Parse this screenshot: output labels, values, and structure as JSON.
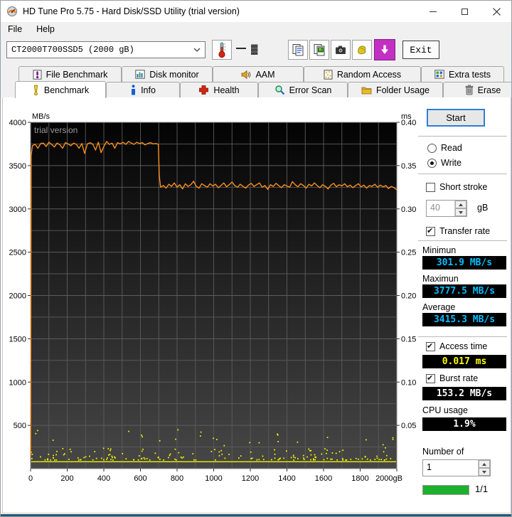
{
  "window": {
    "title": "HD Tune Pro 5.75 - Hard Disk/SSD Utility (trial version)"
  },
  "menu": {
    "file": "File",
    "help": "Help"
  },
  "toolbar": {
    "drive_selector": "CT2000T700SSD5 (2000 gB)",
    "temperature_glyph": "▓",
    "exit_label": "Exit"
  },
  "tabs": {
    "row1": [
      {
        "label": "File Benchmark"
      },
      {
        "label": "Disk monitor"
      },
      {
        "label": "AAM"
      },
      {
        "label": "Random Access"
      },
      {
        "label": "Extra tests"
      }
    ],
    "row2": [
      {
        "label": "Benchmark",
        "active": true
      },
      {
        "label": "Info"
      },
      {
        "label": "Health"
      },
      {
        "label": "Error Scan"
      },
      {
        "label": "Folder Usage"
      },
      {
        "label": "Erase"
      }
    ]
  },
  "controls": {
    "start_label": "Start",
    "read": {
      "label": "Read",
      "checked": false
    },
    "write": {
      "label": "Write",
      "checked": true
    },
    "short_stroke": {
      "label": "Short stroke",
      "checked": false,
      "value": "40",
      "unit": "gB"
    },
    "transfer_rate": {
      "label": "Transfer rate",
      "checked": true
    },
    "minimum": {
      "label": "Minimun",
      "value": "301.9 MB/s"
    },
    "maximum": {
      "label": "Maximun",
      "value": "3777.5 MB/s"
    },
    "average": {
      "label": "Average",
      "value": "3415.3 MB/s"
    },
    "access_time": {
      "label": "Access time",
      "checked": true,
      "value": "0.017 ms"
    },
    "burst_rate": {
      "label": "Burst rate",
      "checked": true,
      "value": "153.2 MB/s"
    },
    "cpu_usage": {
      "label": "CPU usage",
      "value": "1.9%"
    },
    "number_of": {
      "label": "Number of",
      "value": "1"
    },
    "progress": {
      "fraction": 1,
      "text": "1/1"
    }
  },
  "colors": {
    "lcd_cyan": "#00bfff",
    "lcd_yellow": "#ffff00",
    "lcd_white": "#ffffff",
    "progress_green": "#1cb02c",
    "series_orange": "#f78f1e",
    "series_yellow": "#ffff00"
  },
  "chart_data": {
    "type": "line",
    "title_overlay": "trial version",
    "x_axis": {
      "min": 0,
      "max": 2000,
      "tick_step": 200,
      "grid_step": 100,
      "labels": [
        "0",
        "200",
        "400",
        "600",
        "800",
        "1000",
        "1200",
        "1400",
        "1600",
        "1800",
        "2000gB"
      ]
    },
    "y_left": {
      "label": "MB/s",
      "min": 0,
      "max": 4000,
      "tick_step": 500,
      "grid_step": 250,
      "labels": [
        "4000",
        "3500",
        "3000",
        "2500",
        "2000",
        "1500",
        "1000",
        "500"
      ]
    },
    "y_right": {
      "label": "ms",
      "min": 0,
      "max": 0.4,
      "tick_step": 0.05,
      "labels": [
        "0.40",
        "0.35",
        "0.30",
        "0.25",
        "0.20",
        "0.15",
        "0.10",
        "0.05"
      ]
    },
    "series": [
      {
        "name": "write-transfer-rate",
        "color": "#f78f1e",
        "style": "line",
        "points": [
          [
            0,
            150
          ],
          [
            3,
            3620
          ],
          [
            10,
            3730
          ],
          [
            25,
            3745
          ],
          [
            40,
            3700
          ],
          [
            55,
            3755
          ],
          [
            70,
            3760
          ],
          [
            85,
            3720
          ],
          [
            100,
            3770
          ],
          [
            115,
            3745
          ],
          [
            130,
            3715
          ],
          [
            145,
            3760
          ],
          [
            160,
            3740
          ],
          [
            175,
            3700
          ],
          [
            190,
            3765
          ],
          [
            205,
            3750
          ],
          [
            220,
            3730
          ],
          [
            235,
            3760
          ],
          [
            250,
            3745
          ],
          [
            265,
            3700
          ],
          [
            280,
            3755
          ],
          [
            295,
            3640
          ],
          [
            310,
            3750
          ],
          [
            325,
            3765
          ],
          [
            340,
            3745
          ],
          [
            355,
            3680
          ],
          [
            370,
            3770
          ],
          [
            385,
            3650
          ],
          [
            400,
            3720
          ],
          [
            415,
            3780
          ],
          [
            430,
            3745
          ],
          [
            445,
            3760
          ],
          [
            460,
            3700
          ],
          [
            475,
            3765
          ],
          [
            490,
            3750
          ],
          [
            505,
            3770
          ],
          [
            520,
            3745
          ],
          [
            535,
            3780
          ],
          [
            550,
            3760
          ],
          [
            565,
            3745
          ],
          [
            580,
            3770
          ],
          [
            595,
            3755
          ],
          [
            610,
            3765
          ],
          [
            625,
            3740
          ],
          [
            640,
            3755
          ],
          [
            655,
            3765
          ],
          [
            670,
            3750
          ],
          [
            685,
            3755
          ],
          [
            698,
            3745
          ],
          [
            703,
            3380
          ],
          [
            710,
            3250
          ],
          [
            725,
            3270
          ],
          [
            740,
            3240
          ],
          [
            755,
            3285
          ],
          [
            770,
            3260
          ],
          [
            785,
            3300
          ],
          [
            800,
            3250
          ],
          [
            815,
            3280
          ],
          [
            830,
            3230
          ],
          [
            845,
            3290
          ],
          [
            860,
            3260
          ],
          [
            875,
            3280
          ],
          [
            890,
            3320
          ],
          [
            905,
            3260
          ],
          [
            920,
            3240
          ],
          [
            935,
            3290
          ],
          [
            950,
            3270
          ],
          [
            965,
            3250
          ],
          [
            980,
            3290
          ],
          [
            995,
            3265
          ],
          [
            1010,
            3285
          ],
          [
            1025,
            3245
          ],
          [
            1040,
            3270
          ],
          [
            1055,
            3300
          ],
          [
            1070,
            3255
          ],
          [
            1085,
            3280
          ],
          [
            1100,
            3310
          ],
          [
            1115,
            3270
          ],
          [
            1130,
            3250
          ],
          [
            1145,
            3285
          ],
          [
            1160,
            3260
          ],
          [
            1175,
            3240
          ],
          [
            1190,
            3275
          ],
          [
            1205,
            3295
          ],
          [
            1220,
            3260
          ],
          [
            1235,
            3280
          ],
          [
            1250,
            3300
          ],
          [
            1265,
            3250
          ],
          [
            1280,
            3270
          ],
          [
            1295,
            3225
          ],
          [
            1310,
            3280
          ],
          [
            1325,
            3260
          ],
          [
            1340,
            3295
          ],
          [
            1355,
            3270
          ],
          [
            1370,
            3245
          ],
          [
            1385,
            3280
          ],
          [
            1400,
            3265
          ],
          [
            1415,
            3250
          ],
          [
            1430,
            3315
          ],
          [
            1445,
            3280
          ],
          [
            1460,
            3255
          ],
          [
            1475,
            3290
          ],
          [
            1490,
            3270
          ],
          [
            1505,
            3240
          ],
          [
            1520,
            3285
          ],
          [
            1535,
            3265
          ],
          [
            1550,
            3300
          ],
          [
            1565,
            3270
          ],
          [
            1580,
            3245
          ],
          [
            1595,
            3280
          ],
          [
            1610,
            3260
          ],
          [
            1625,
            3230
          ],
          [
            1640,
            3275
          ],
          [
            1655,
            3295
          ],
          [
            1670,
            3255
          ],
          [
            1685,
            3280
          ],
          [
            1700,
            3265
          ],
          [
            1715,
            3290
          ],
          [
            1730,
            3255
          ],
          [
            1745,
            3275
          ],
          [
            1760,
            3245
          ],
          [
            1775,
            3270
          ],
          [
            1790,
            3290
          ],
          [
            1805,
            3255
          ],
          [
            1820,
            3275
          ],
          [
            1835,
            3240
          ],
          [
            1850,
            3270
          ],
          [
            1865,
            3260
          ],
          [
            1880,
            3285
          ],
          [
            1895,
            3250
          ],
          [
            1910,
            3275
          ],
          [
            1925,
            3255
          ],
          [
            1940,
            3270
          ],
          [
            1955,
            3235
          ],
          [
            1970,
            3260
          ],
          [
            1985,
            3245
          ],
          [
            2000,
            3220
          ]
        ]
      },
      {
        "name": "access-time-dots",
        "color": "#ffff00",
        "style": "scatter",
        "typical_ms": 0.017,
        "baseline_ms": 0.008,
        "band_min_ms": 0.01,
        "band_max_ms": 0.024,
        "outlier_chance": 0.1,
        "outlier_max_ms": 0.048,
        "dot_count": 190,
        "seed": 123456
      }
    ]
  }
}
